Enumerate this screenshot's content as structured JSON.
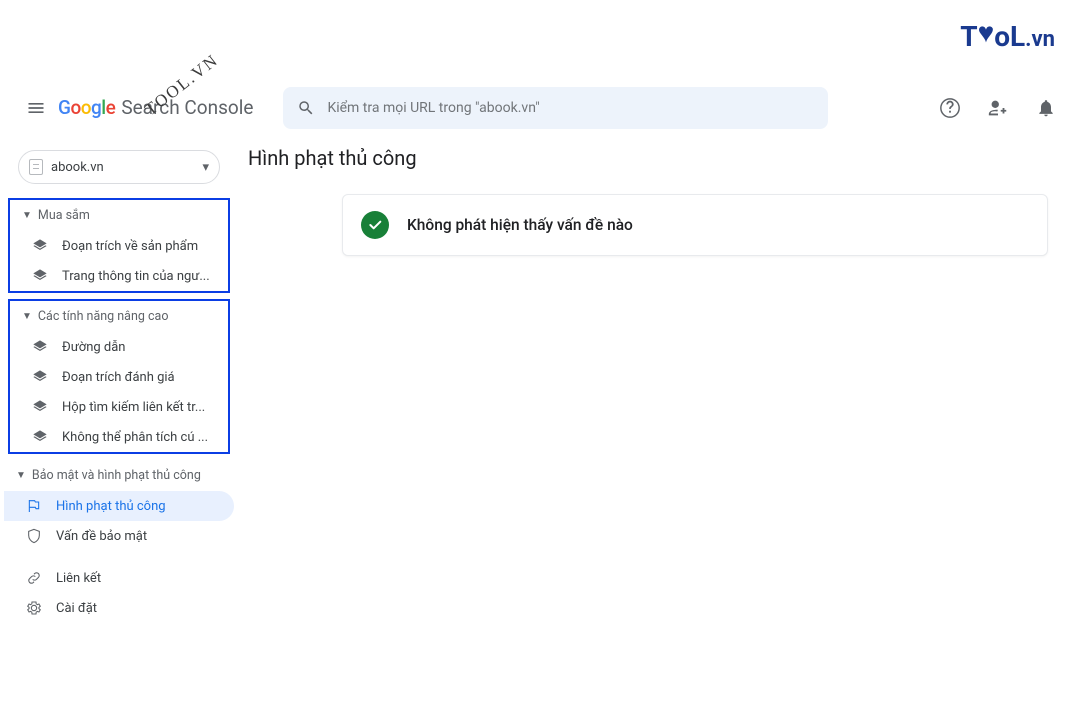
{
  "watermark": {
    "top": "TooL.vn",
    "diag": "TOOL.VN"
  },
  "brand": {
    "google": "Google",
    "product": "Search Console"
  },
  "search": {
    "placeholder": "Kiểm tra mọi URL trong \"abook.vn\""
  },
  "property": {
    "label": "abook.vn"
  },
  "sidebar": {
    "section_shopping": "Mua sắm",
    "shopping_items": [
      "Đoạn trích về sản phẩm",
      "Trang thông tin của ngư..."
    ],
    "section_enhancements": "Các tính năng nâng cao",
    "enh_items": [
      "Đường dẫn",
      "Đoạn trích đánh giá",
      "Hộp tìm kiếm liên kết tr...",
      "Không thể phân tích cú ..."
    ],
    "section_security": "Bảo mật và hình phạt thủ công",
    "sec_items": [
      "Hình phạt thủ công",
      "Vấn đề bảo mật"
    ],
    "links": "Liên kết",
    "settings": "Cài đặt"
  },
  "main": {
    "title": "Hình phạt thủ công",
    "status": "Không phát hiện thấy vấn đề nào"
  }
}
